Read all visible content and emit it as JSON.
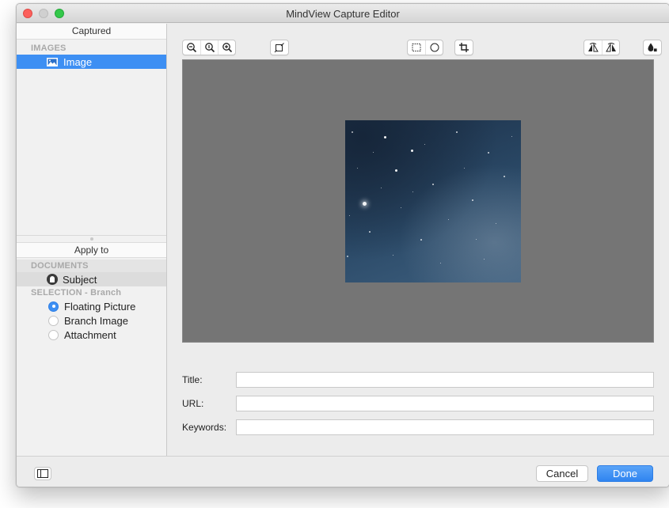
{
  "window": {
    "title": "MindView Capture Editor"
  },
  "sidebar": {
    "captured_header": "Captured",
    "images_label": "IMAGES",
    "images": [
      {
        "label": "Image",
        "icon": "picture-icon",
        "selected": true
      }
    ],
    "apply_header": "Apply to",
    "documents_label": "DOCUMENTS",
    "documents": [
      {
        "label": "Subject",
        "icon": "subject-icon"
      }
    ],
    "selection_label": "SELECTION - Branch",
    "options": [
      {
        "label": "Floating Picture",
        "checked": true
      },
      {
        "label": "Branch Image",
        "checked": false
      },
      {
        "label": "Attachment",
        "checked": false
      }
    ]
  },
  "toolbar": {
    "zoom_group": [
      "zoom-out-icon",
      "zoom-actual-icon",
      "zoom-in-icon"
    ],
    "transform": [
      "resize-icon"
    ],
    "selection_group": [
      "rectangle-select-icon",
      "ellipse-select-icon"
    ],
    "crop": [
      "crop-icon"
    ],
    "flip_group": [
      "flip-horizontal-icon",
      "flip-vertical-icon"
    ],
    "color": [
      "color-adjust-icon"
    ]
  },
  "form": {
    "title_label": "Title:",
    "title_value": "",
    "url_label": "URL:",
    "url_value": "",
    "keywords_label": "Keywords:",
    "keywords_value": ""
  },
  "footer": {
    "cancel_label": "Cancel",
    "done_label": "Done"
  },
  "colors": {
    "accent": "#3d8ff3",
    "canvas": "#757575",
    "window": "#ececec"
  }
}
